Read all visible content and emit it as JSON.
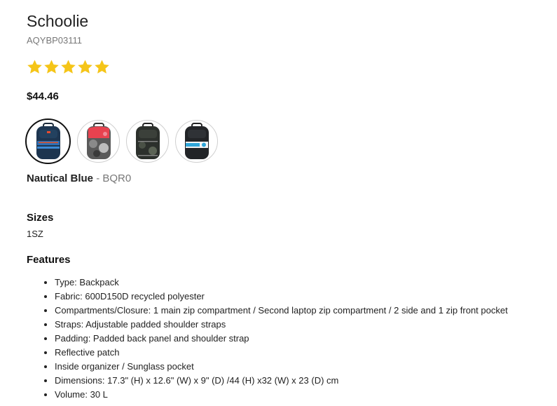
{
  "product": {
    "name": "Schoolie",
    "sku": "AQYBP03111",
    "rating": 5,
    "rating_max": 5,
    "price": "$44.46"
  },
  "swatches": [
    {
      "name": "nautical-blue",
      "selected": true
    },
    {
      "name": "red-camo",
      "selected": false
    },
    {
      "name": "dark-camo",
      "selected": false
    },
    {
      "name": "black-blue-stripe",
      "selected": false
    }
  ],
  "selected_color": {
    "name": "Nautical Blue",
    "separator": "-",
    "code": "BQR0"
  },
  "sizes": {
    "label": "Sizes",
    "value": "1SZ"
  },
  "features": {
    "label": "Features",
    "items": [
      "Type: Backpack",
      "Fabric: 600D150D recycled polyester",
      "Compartments/Closure: 1 main zip compartment / Second laptop zip compartment / 2 side and 1 zip front pocket",
      "Straps: Adjustable padded shoulder straps",
      "Padding: Padded back panel and shoulder strap",
      "Reflective patch",
      "Inside organizer / Sunglass pocket",
      "Dimensions: 17.3\" (H) x 12.6\" (W) x 9\" (D) /44 (H) x32 (W) x 23 (D) cm",
      "Volume: 30 L"
    ]
  },
  "colors": {
    "star": "#f5c518",
    "text": "#222222",
    "muted": "#777777"
  }
}
